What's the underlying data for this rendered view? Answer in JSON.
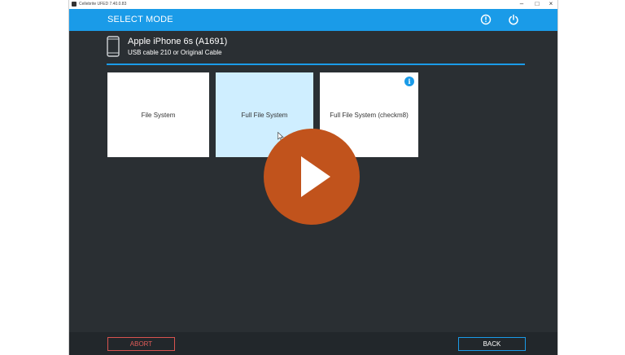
{
  "window": {
    "title": "Cellebrite UFED 7.40.0.83"
  },
  "header": {
    "title": "SELECT MODE"
  },
  "device": {
    "name": "Apple iPhone 6s (A1691)",
    "cable": "USB cable 210 or Original Cable"
  },
  "modes": [
    {
      "label": "File System"
    },
    {
      "label": "Full File System"
    },
    {
      "label": "Full File System (checkm8)",
      "info": "i"
    }
  ],
  "footer": {
    "abort_label": "ABORT",
    "back_label": "BACK"
  },
  "colors": {
    "accent": "#1a9be8",
    "background": "#2a2f33",
    "selected_tile": "#cfeeff",
    "abort": "#d9534f",
    "play_button": "#c1531c"
  },
  "icons": [
    "info-icon",
    "power-icon",
    "phone-icon",
    "play-icon",
    "minimize-icon",
    "maximize-icon",
    "close-icon"
  ]
}
